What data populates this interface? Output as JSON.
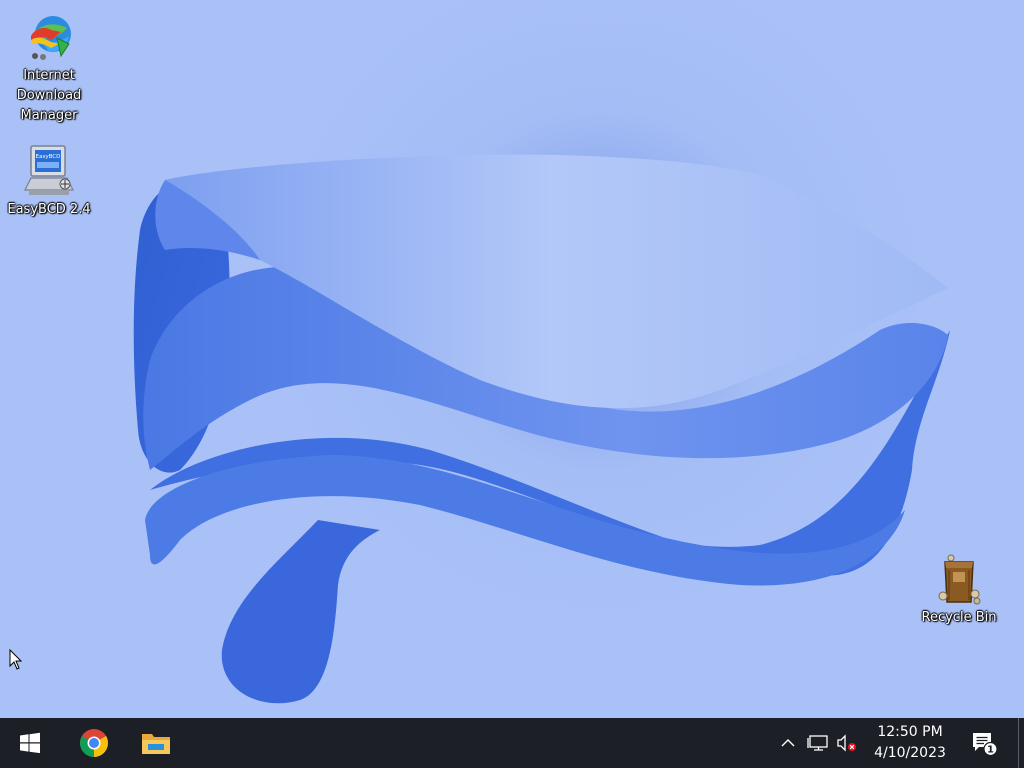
{
  "desktop": {
    "background_color": "#a9c1f7",
    "icons": [
      {
        "label": "Internet Download Manager",
        "icon": "idm-globe-icon"
      },
      {
        "label": "EasyBCD 2.4",
        "icon": "easybcd-monitor-icon",
        "screen_text": "EasyBCD"
      },
      {
        "label": "Recycle Bin",
        "icon": "recycle-bin-icon"
      }
    ]
  },
  "taskbar": {
    "background_color": "#1c1f26",
    "pinned": [
      {
        "icon": "windows-start-icon"
      },
      {
        "icon": "chrome-icon"
      },
      {
        "icon": "file-explorer-icon"
      }
    ],
    "tray": {
      "icons": [
        "chevron-up-icon",
        "network-icon",
        "volume-muted-icon"
      ],
      "time": "12:50 PM",
      "date": "4/10/2023",
      "notification_count": "1"
    }
  }
}
